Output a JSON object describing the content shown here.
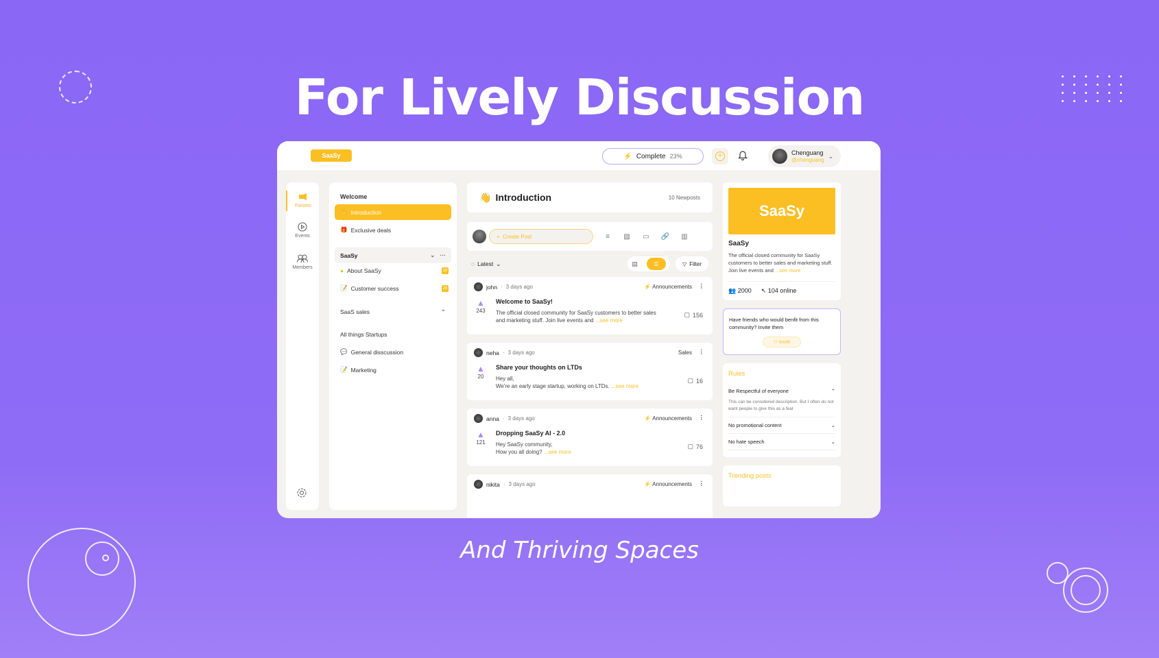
{
  "hero": {
    "title": "For Lively Discussion",
    "subtitle": "And Thriving Spaces"
  },
  "topbar": {
    "logo": "SaaSy",
    "complete_label": "Complete",
    "complete_pct": "23%",
    "progress": 0.23,
    "user_name": "Chenguang",
    "user_handle": "@chenguang"
  },
  "rail": [
    {
      "label": "Forums",
      "icon": "megaphone-icon"
    },
    {
      "label": "Events",
      "icon": "play-circle-icon"
    },
    {
      "label": "Members",
      "icon": "members-icon"
    }
  ],
  "nav": {
    "welcome": "Welcome",
    "introduction": "Introduction",
    "exclusive": "Exclusive deals",
    "group": "SaaSy",
    "about": "About SaaSy",
    "about_badge": "10",
    "customer": "Customer success",
    "customer_badge": "26",
    "sales": "SaaS sales",
    "startups": "All things Startups",
    "general": "General disscussion",
    "marketing": "Marketing"
  },
  "main": {
    "title": "Introduction",
    "newposts": "10 Newposts",
    "create_post": "Create Post",
    "sort": "Latest",
    "filter": "Filter",
    "posts": [
      {
        "author": "john",
        "time": "3 days ago",
        "category": "Announcements",
        "title": "Welcome to SaaSy!",
        "line1": "The official closed community for SaaSy customers to better sales",
        "line2": "and marketing stuff. Join live events and",
        "votes": "243",
        "comments": "156"
      },
      {
        "author": "neha",
        "time": "3 days ago",
        "category": "Sales",
        "title": "Share your thoughts on LTDs",
        "line1": "Hey all,",
        "line2": "We're an early stage startup, working on LTDs.",
        "votes": "20",
        "comments": "16"
      },
      {
        "author": "anna",
        "time": "3 days ago",
        "category": "Announcements",
        "title": "Dropping SaaSy AI - 2.0",
        "line1": "Hey SaaSy community,",
        "line2": "How you all doing?",
        "votes": "121",
        "comments": "76"
      },
      {
        "author": "nikita",
        "time": "3 days ago",
        "category": "Announcements"
      }
    ],
    "see_more": "...see more"
  },
  "side": {
    "brand": "SaaSy",
    "name": "SaaSy",
    "desc": "The official closed community for SaaSy customers to better sales and marketing stuff. Join live events and",
    "members": "2000",
    "online": "104 online",
    "invite_text": "Have friends who would benfit from this community? Invite them",
    "invite_btn": "Invite",
    "rules_title": "Rules",
    "rules": [
      {
        "title": "Be Respectful of everyone",
        "desc": "This can be considered description. But I often do not want people to give this as a feat"
      },
      {
        "title": "No promotional content"
      },
      {
        "title": "No hate speech"
      }
    ],
    "trending": "Trending posts"
  }
}
